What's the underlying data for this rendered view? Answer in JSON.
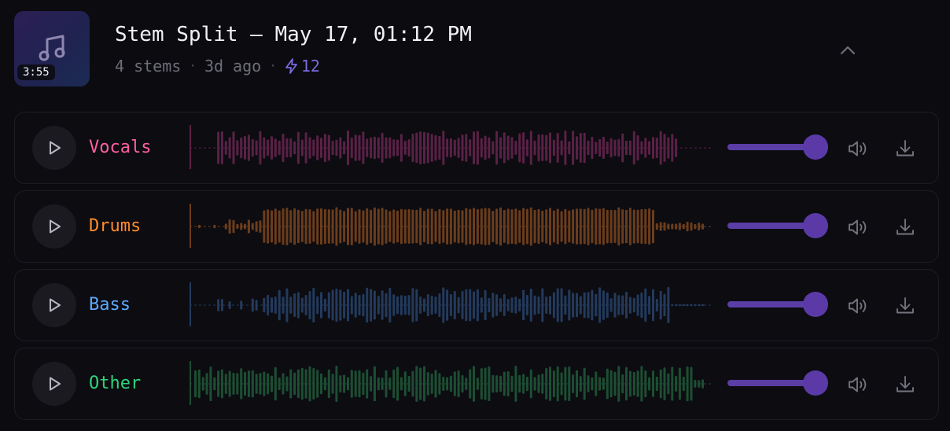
{
  "header": {
    "duration": "3:55",
    "title": "Stem Split — May 17, 01:12 PM",
    "stems_count": "4 stems",
    "time_ago": "3d ago",
    "credits": "12",
    "icons": {
      "thumbnail": "music-note-icon",
      "credits": "lightning-icon",
      "collapse": "chevron-up-icon"
    }
  },
  "colors": {
    "accent": "#7b6be0",
    "slider": "#5b3da6",
    "muted_text": "#6e6e78"
  },
  "stems": [
    {
      "id": "vocals",
      "name": "Vocals",
      "color": "#ff5fa2",
      "wave_color": "#5a2146",
      "volume": 1.0
    },
    {
      "id": "drums",
      "name": "Drums",
      "color": "#ff8a2a",
      "wave_color": "#6b3d1c",
      "volume": 1.0
    },
    {
      "id": "bass",
      "name": "Bass",
      "color": "#5ea8ff",
      "wave_color": "#233a5c",
      "volume": 1.0
    },
    {
      "id": "other",
      "name": "Other",
      "color": "#2fd37a",
      "wave_color": "#1d4e33",
      "volume": 1.0
    }
  ],
  "row_icons": {
    "play": "play-icon",
    "volume": "speaker-icon",
    "download": "download-icon"
  }
}
